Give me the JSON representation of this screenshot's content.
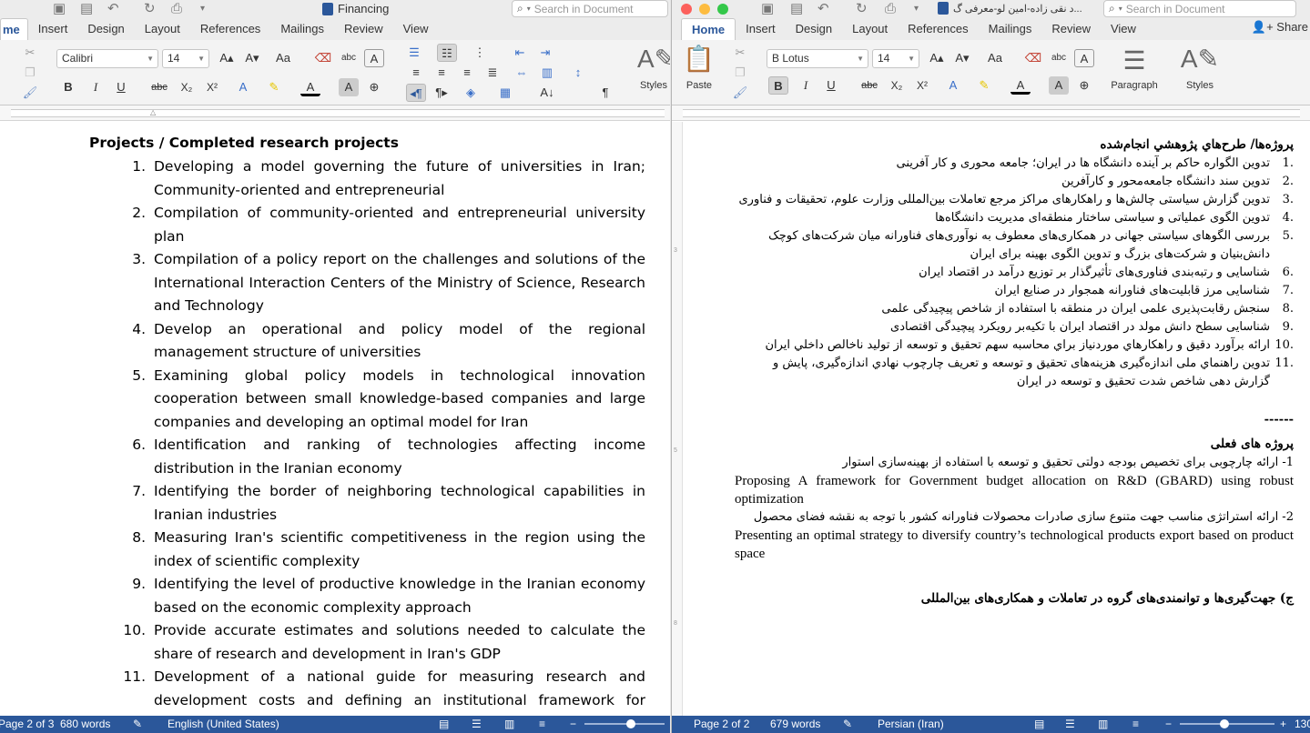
{
  "left": {
    "title": "Financing",
    "search_placeholder": "Search in Document",
    "tabs": [
      "me",
      "Insert",
      "Design",
      "Layout",
      "References",
      "Mailings",
      "Review",
      "View"
    ],
    "font": "Calibri",
    "size": "14",
    "styles_label": "Styles",
    "heading": "Projects / Completed research projects",
    "items": [
      {
        "n": "1.",
        "t": "Developing a model governing the future of universities in Iran; Community-oriented and entrepreneurial"
      },
      {
        "n": "2.",
        "t": "Compilation of community-oriented and entrepreneurial university plan"
      },
      {
        "n": "3.",
        "t": "Compilation of a policy report on the challenges and solutions of the International Interaction Centers of the Ministry of Science, Research and Technology"
      },
      {
        "n": "4.",
        "t": "Develop an operational and policy model of the regional management structure of universities"
      },
      {
        "n": "5.",
        "t": "Examining global policy models in technological innovation cooperation between small knowledge-based companies and large companies and developing an optimal model for Iran"
      },
      {
        "n": "6.",
        "t": "Identification and ranking of technologies affecting income distribution in the Iranian economy"
      },
      {
        "n": "7.",
        "t": "Identifying the border of neighboring technological capabilities in Iranian industries"
      },
      {
        "n": "8.",
        "t": "Measuring Iran's scientific competitiveness in the region using the index of scientific complexity"
      },
      {
        "n": "9.",
        "t": "Identifying the level of productive knowledge in the Iranian economy based on the economic complexity approach"
      },
      {
        "n": "10.",
        "t": "Provide accurate estimates and solutions needed to calculate the share of research and development in Iran's GDP"
      },
      {
        "n": "11.",
        "t": "Development of a national guide for measuring research and development costs and defining an institutional framework for measuring, monitoring and reporting the R&D intensity index in Iran"
      }
    ],
    "status": {
      "page": "Page 2 of 3",
      "words": "680 words",
      "language": "English (United States)"
    }
  },
  "right": {
    "title": "د نقی زاده-امین لو-معرفی گ...",
    "search_placeholder": "Search in Document",
    "share": "Share",
    "tabs": [
      "Home",
      "Insert",
      "Design",
      "Layout",
      "References",
      "Mailings",
      "Review",
      "View"
    ],
    "paste_label": "Paste",
    "font": "B Lotus",
    "size": "14",
    "paragraph_label": "Paragraph",
    "styles_label": "Styles",
    "heading": "پروژه‌ها/ طرح‌هاي پژوهشي انجام‌شده",
    "items": [
      {
        "n": "1.",
        "t": "تدوین الگواره حاکم بر آینده دانشگاه ها در ایران؛ جامعه محوری و کار آفرینی"
      },
      {
        "n": "2.",
        "t": "تدوین سند دانشگاه جامعه‌محور و کارآفرین"
      },
      {
        "n": "3.",
        "t": "تدوین گزارش سیاستی چالش‌ها و راهکارهای مراکز مرجع تعاملات بین‌المللی وزارت علوم، تحقیقات و فناوری"
      },
      {
        "n": "4.",
        "t": "تدوین الگوی عملیاتی و سیاستی ساختار منطقه‌ای مدیریت دانشگاه‌ها"
      },
      {
        "n": "5.",
        "t": "بررسی الگوهای سیاستی جهانی در همکاری‌های معطوف به نوآوری‌های فناورانه میان شرکت‌های کوچک دانش‌بنیان و شرکت‌های بزرگ و تدوین الگوی بهینه برای ایران"
      },
      {
        "n": "6.",
        "t": "شناسایی و رتبه‌بندی فناوری‌های تأثیرگذار بر توزیع درآمد در اقتصاد ایران"
      },
      {
        "n": "7.",
        "t": "شناسایی مرز قابلیت‌های فناورانه همجوار در صنایع ایران"
      },
      {
        "n": "8.",
        "t": "سنجش رقابت‌پذیری علمی ایران در منطقه با استفاده از شاخص پیچیدگی علمی"
      },
      {
        "n": "9.",
        "t": "شناسایی سطح دانش مولد در اقتصاد ایران با تکیه‌بر رویکرد پیچیدگی اقتصادی"
      },
      {
        "n": "10.",
        "t": "ارائه برآورد دقيق و راهكارهاي موردنياز براي محاسبه سهم تحقيق و توسعه از توليد ناخالص داخلي ايران"
      },
      {
        "n": "11.",
        "t": "تدوين راهنماي ملی اندازه‌گیری هزینه‌های تحقیق و توسعه و تعریف چارچوب نهادي اندازه‌گيری، پایش و گزارش دهی شاخص شدت تحقیق و توسعه در ایران"
      }
    ],
    "separator": "------",
    "current_heading": "پروژه های فعلی",
    "current": [
      {
        "fa": "1- ارائه چارچوبی برای تخصیص بودجه دولتی تحقیق و توسعه با استفاده از بهینه‌سازی استوار",
        "en": "Proposing A framework for Government budget allocation on R&D (GBARD) using robust optimization"
      },
      {
        "fa": "2- ارائه استراتژی مناسب جهت متنوع سازی صادرات محصولات فناورانه کشور با توجه به نقشه فضای محصول",
        "en": "Presenting an optimal strategy to diversify country’s technological products export based on product space"
      }
    ],
    "section_c": "ج) جهت‌گیری‌ها و توانمندی‌های گروه در تعاملات و همکاری‌های بین‌المللی",
    "status": {
      "page": "Page 2 of 2",
      "words": "679 words",
      "language": "Persian (Iran)",
      "zoom": "130"
    }
  }
}
